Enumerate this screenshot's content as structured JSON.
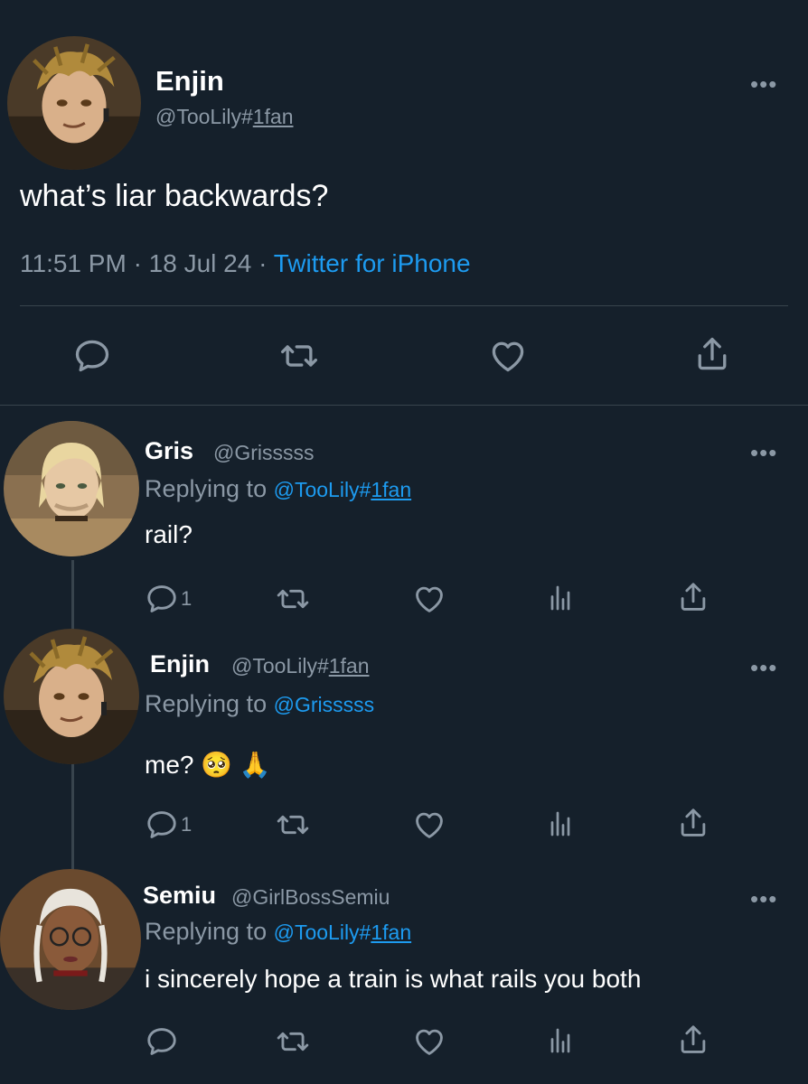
{
  "main_tweet": {
    "name": "Enjin",
    "handle_prefix": "@TooLily#",
    "handle_suffix": "1fan",
    "text": "what’s liar backwards?",
    "time": "11:51 PM",
    "date": "18 Jul 24",
    "source": "Twitter for iPhone",
    "sep": "·"
  },
  "replies": [
    {
      "name": "Gris",
      "handle": "@Grisssss",
      "replying_label": "Replying to",
      "replying_prefix": "@TooLily#",
      "replying_suffix": "1fan",
      "text": "rail?",
      "reply_count": "1"
    },
    {
      "name": "Enjin",
      "handle_prefix": "@TooLily#",
      "handle_suffix": "1fan",
      "replying_label": "Replying to",
      "replying_handle": "@Grisssss",
      "text": "me? 🥺 🙏",
      "reply_count": "1"
    },
    {
      "name": "Semiu",
      "handle": "@GirlBossSemiu",
      "replying_label": "Replying to",
      "replying_prefix": "@TooLily#",
      "replying_suffix": "1fan",
      "text": "i sincerely hope a train is what rails you both"
    }
  ],
  "more_glyph": "•••",
  "colors": {
    "background": "#15202b",
    "secondary_text": "#8b98a5",
    "link": "#1d9bf0",
    "divider": "#38444d"
  },
  "icons": [
    "comment-icon",
    "retweet-icon",
    "like-icon",
    "share-icon",
    "analytics-icon",
    "more-icon"
  ]
}
